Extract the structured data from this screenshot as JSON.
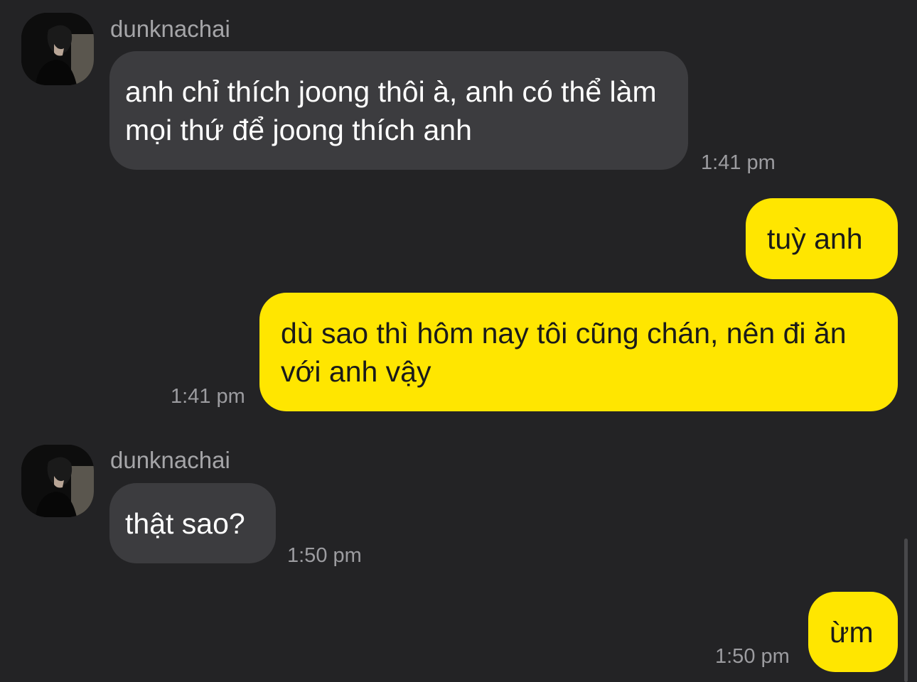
{
  "colors": {
    "background": "#232325",
    "incoming_bubble": "#3c3c3f",
    "outgoing_bubble": "#ffe600",
    "incoming_text": "#ffffff",
    "outgoing_text": "#1a1a1a",
    "meta_text": "#9c9ca0"
  },
  "messages": [
    {
      "direction": "incoming",
      "sender": "dunknachai",
      "text": "anh chỉ thích joong thôi à, anh có thể làm mọi thứ để joong thích anh",
      "time": "1:41 pm"
    },
    {
      "direction": "outgoing",
      "text": "tuỳ anh",
      "time": ""
    },
    {
      "direction": "outgoing",
      "text": "dù sao thì hôm nay tôi cũng chán, nên đi ăn với anh vậy",
      "time": "1:41 pm"
    },
    {
      "direction": "incoming",
      "sender": "dunknachai",
      "text": "thật sao?",
      "time": "1:50 pm"
    },
    {
      "direction": "outgoing",
      "text": "ừm",
      "time": "1:50 pm"
    }
  ]
}
